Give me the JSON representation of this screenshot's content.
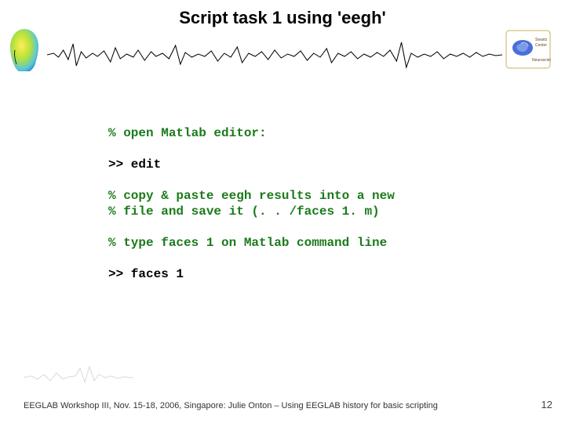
{
  "title": "Script task 1 using 'eegh'",
  "code": {
    "line1": "% open Matlab editor:",
    "line2": ">> edit",
    "line3": "% copy & paste eegh results into a new",
    "line4": "% file and save it (. . /faces 1. m)",
    "line5": "% type faces 1 on Matlab command line",
    "line6": ">> faces 1"
  },
  "footer": "EEGLAB Workshop III, Nov. 15-18, 2006, Singapore: Julie Onton – Using EEGLAB history for basic scripting",
  "page_number": "12",
  "icons": {
    "head": "head-model-icon",
    "eeg": "eeg-waveform-icon",
    "logo": "neuroscience-logo-icon",
    "squiggle": "faint-waveform-icon"
  }
}
